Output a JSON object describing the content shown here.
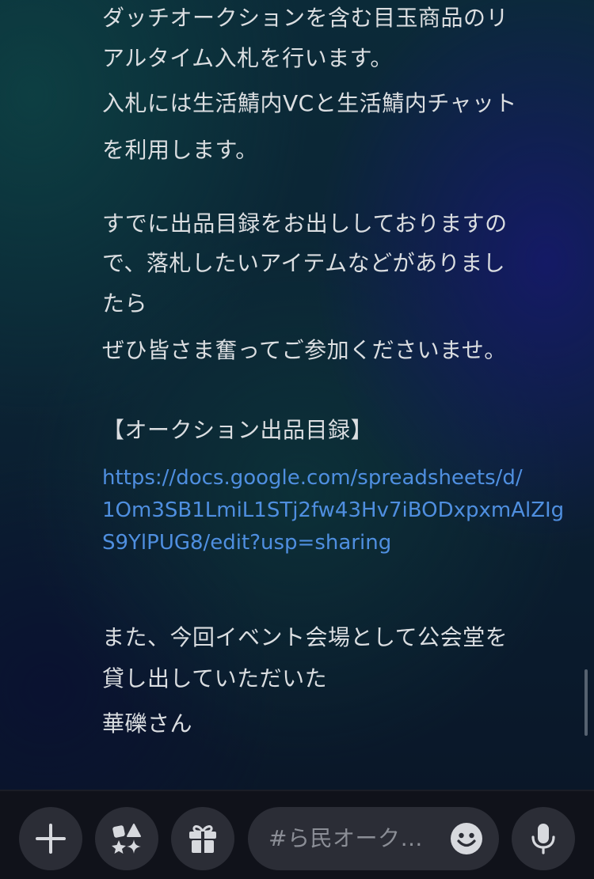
{
  "message": {
    "lines": [
      "ダッチオークションを含む目玉商品のリ",
      "アルタイム入札を行います。",
      "入札には生活鯖内VCと生活鯖内チャット",
      "を利用します。",
      "すでに出品目録をお出ししておりますの",
      "で、落札したいアイテムなどがありまし",
      "たら",
      "ぜひ皆さま奮ってご参加くださいませ。",
      "【オークション出品目録】",
      "また、今回イベント会場として公会堂を",
      "貸し出していただいた",
      "華礫さん"
    ],
    "link_lines": [
      "https://docs.google.com/spreadsheets/d/",
      "1Om3SB1LmiL1STj2fw43Hv7iBODxpxmAlZIg",
      "S9YlPUG8/edit?usp=sharing"
    ]
  },
  "composer": {
    "placeholder": "#ら民オークション"
  },
  "icons": {
    "add": "plus-icon",
    "apps": "apps-icon",
    "gift": "gift-icon",
    "emoji": "emoji-icon",
    "mic": "microphone-icon"
  },
  "colors": {
    "text": "#dbdee1",
    "link": "#4f8fe0",
    "button_bg": "#2b2d36",
    "bar_bg": "#10121a"
  }
}
